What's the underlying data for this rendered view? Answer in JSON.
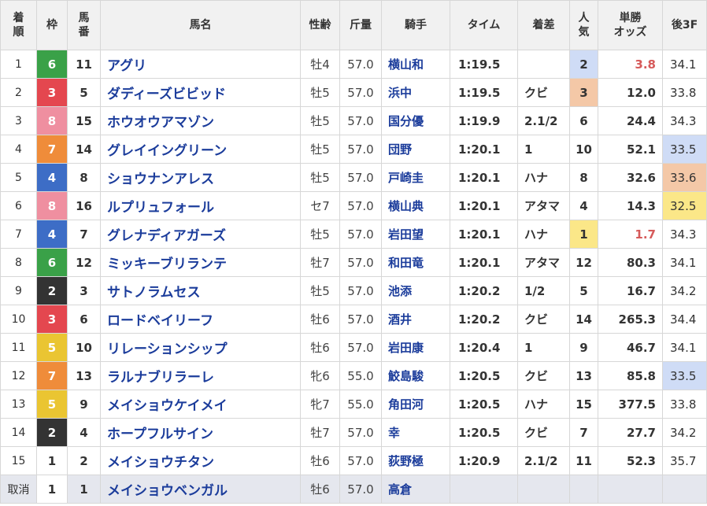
{
  "colors": {
    "waku": {
      "1": {
        "bg": "#ffffff",
        "fg": "#333333"
      },
      "2": {
        "bg": "#333333",
        "fg": "#ffffff"
      },
      "3": {
        "bg": "#e4474f",
        "fg": "#ffffff"
      },
      "4": {
        "bg": "#3d6dc6",
        "fg": "#ffffff"
      },
      "5": {
        "bg": "#eac532",
        "fg": "#ffffff"
      },
      "6": {
        "bg": "#3aa148",
        "fg": "#ffffff"
      },
      "7": {
        "bg": "#ef8c3a",
        "fg": "#ffffff"
      },
      "8": {
        "bg": "#ef8fa0",
        "fg": "#ffffff"
      }
    },
    "ninki_highlight": {
      "1": "#fbe788",
      "2": "#cfdcf6",
      "3": "#f4c8a7"
    },
    "last3f_highlight": {
      "1": "#f4c8a7",
      "2": "#fbe788",
      "3": "#cfdcf6"
    },
    "odds_hot": "#d65a5a"
  },
  "headers": {
    "rank": "着\n順",
    "waku": "枠",
    "umaban": "馬\n番",
    "name": "馬名",
    "sex_age": "性齢",
    "kinryo": "斤量",
    "jockey": "騎手",
    "time": "タイム",
    "margin": "着差",
    "ninki": "人\n気",
    "odds": "単勝\nオッズ",
    "last3f": "後3F"
  },
  "rows": [
    {
      "rank": "1",
      "waku": "6",
      "umaban": "11",
      "name": "アグリ",
      "sex_age": "牡4",
      "kinryo": "57.0",
      "jockey": "横山和",
      "time": "1:19.5",
      "margin": "",
      "ninki": "2",
      "odds": "3.8",
      "last3f": "34.1",
      "ninki_hl": "2",
      "odds_hot": true,
      "last3f_hl": ""
    },
    {
      "rank": "2",
      "waku": "3",
      "umaban": "5",
      "name": "ダディーズビビッド",
      "sex_age": "牡5",
      "kinryo": "57.0",
      "jockey": "浜中",
      "time": "1:19.5",
      "margin": "クビ",
      "ninki": "3",
      "odds": "12.0",
      "last3f": "33.8",
      "ninki_hl": "3",
      "odds_hot": false,
      "last3f_hl": ""
    },
    {
      "rank": "3",
      "waku": "8",
      "umaban": "15",
      "name": "ホウオウアマゾン",
      "sex_age": "牡5",
      "kinryo": "57.0",
      "jockey": "国分優",
      "time": "1:19.9",
      "margin": "2.1/2",
      "ninki": "6",
      "odds": "24.4",
      "last3f": "34.3",
      "ninki_hl": "",
      "odds_hot": false,
      "last3f_hl": ""
    },
    {
      "rank": "4",
      "waku": "7",
      "umaban": "14",
      "name": "グレイイングリーン",
      "sex_age": "牡5",
      "kinryo": "57.0",
      "jockey": "団野",
      "time": "1:20.1",
      "margin": "1",
      "ninki": "10",
      "odds": "52.1",
      "last3f": "33.5",
      "ninki_hl": "",
      "odds_hot": false,
      "last3f_hl": "3"
    },
    {
      "rank": "5",
      "waku": "4",
      "umaban": "8",
      "name": "ショウナンアレス",
      "sex_age": "牡5",
      "kinryo": "57.0",
      "jockey": "戸崎圭",
      "time": "1:20.1",
      "margin": "ハナ",
      "ninki": "8",
      "odds": "32.6",
      "last3f": "33.6",
      "ninki_hl": "",
      "odds_hot": false,
      "last3f_hl": "1"
    },
    {
      "rank": "6",
      "waku": "8",
      "umaban": "16",
      "name": "ルプリュフォール",
      "sex_age": "セ7",
      "kinryo": "57.0",
      "jockey": "横山典",
      "time": "1:20.1",
      "margin": "アタマ",
      "ninki": "4",
      "odds": "14.3",
      "last3f": "32.5",
      "ninki_hl": "",
      "odds_hot": false,
      "last3f_hl": "2"
    },
    {
      "rank": "7",
      "waku": "4",
      "umaban": "7",
      "name": "グレナディアガーズ",
      "sex_age": "牡5",
      "kinryo": "57.0",
      "jockey": "岩田望",
      "time": "1:20.1",
      "margin": "ハナ",
      "ninki": "1",
      "odds": "1.7",
      "last3f": "34.3",
      "ninki_hl": "1",
      "odds_hot": true,
      "last3f_hl": ""
    },
    {
      "rank": "8",
      "waku": "6",
      "umaban": "12",
      "name": "ミッキーブリランテ",
      "sex_age": "牡7",
      "kinryo": "57.0",
      "jockey": "和田竜",
      "time": "1:20.1",
      "margin": "アタマ",
      "ninki": "12",
      "odds": "80.3",
      "last3f": "34.1",
      "ninki_hl": "",
      "odds_hot": false,
      "last3f_hl": ""
    },
    {
      "rank": "9",
      "waku": "2",
      "umaban": "3",
      "name": "サトノラムセス",
      "sex_age": "牡5",
      "kinryo": "57.0",
      "jockey": "池添",
      "time": "1:20.2",
      "margin": "1/2",
      "ninki": "5",
      "odds": "16.7",
      "last3f": "34.2",
      "ninki_hl": "",
      "odds_hot": false,
      "last3f_hl": ""
    },
    {
      "rank": "10",
      "waku": "3",
      "umaban": "6",
      "name": "ロードベイリーフ",
      "sex_age": "牡6",
      "kinryo": "57.0",
      "jockey": "酒井",
      "time": "1:20.2",
      "margin": "クビ",
      "ninki": "14",
      "odds": "265.3",
      "last3f": "34.4",
      "ninki_hl": "",
      "odds_hot": false,
      "last3f_hl": ""
    },
    {
      "rank": "11",
      "waku": "5",
      "umaban": "10",
      "name": "リレーションシップ",
      "sex_age": "牡6",
      "kinryo": "57.0",
      "jockey": "岩田康",
      "time": "1:20.4",
      "margin": "1",
      "ninki": "9",
      "odds": "46.7",
      "last3f": "34.1",
      "ninki_hl": "",
      "odds_hot": false,
      "last3f_hl": ""
    },
    {
      "rank": "12",
      "waku": "7",
      "umaban": "13",
      "name": "ラルナブリラーレ",
      "sex_age": "牝6",
      "kinryo": "55.0",
      "jockey": "鮫島駿",
      "time": "1:20.5",
      "margin": "クビ",
      "ninki": "13",
      "odds": "85.8",
      "last3f": "33.5",
      "ninki_hl": "",
      "odds_hot": false,
      "last3f_hl": "3"
    },
    {
      "rank": "13",
      "waku": "5",
      "umaban": "9",
      "name": "メイショウケイメイ",
      "sex_age": "牝7",
      "kinryo": "55.0",
      "jockey": "角田河",
      "time": "1:20.5",
      "margin": "ハナ",
      "ninki": "15",
      "odds": "377.5",
      "last3f": "33.8",
      "ninki_hl": "",
      "odds_hot": false,
      "last3f_hl": ""
    },
    {
      "rank": "14",
      "waku": "2",
      "umaban": "4",
      "name": "ホープフルサイン",
      "sex_age": "牡7",
      "kinryo": "57.0",
      "jockey": "幸",
      "time": "1:20.5",
      "margin": "クビ",
      "ninki": "7",
      "odds": "27.7",
      "last3f": "34.2",
      "ninki_hl": "",
      "odds_hot": false,
      "last3f_hl": ""
    },
    {
      "rank": "15",
      "waku": "1",
      "umaban": "2",
      "name": "メイショウチタン",
      "sex_age": "牡6",
      "kinryo": "57.0",
      "jockey": "荻野極",
      "time": "1:20.9",
      "margin": "2.1/2",
      "ninki": "11",
      "odds": "52.3",
      "last3f": "35.7",
      "ninki_hl": "",
      "odds_hot": false,
      "last3f_hl": ""
    },
    {
      "rank": "取消",
      "waku": "1",
      "umaban": "1",
      "name": "メイショウベンガル",
      "sex_age": "牡6",
      "kinryo": "57.0",
      "jockey": "高倉",
      "time": "",
      "margin": "",
      "ninki": "",
      "odds": "",
      "last3f": "",
      "ninki_hl": "",
      "odds_hot": false,
      "last3f_hl": "",
      "cancelled": true
    }
  ]
}
